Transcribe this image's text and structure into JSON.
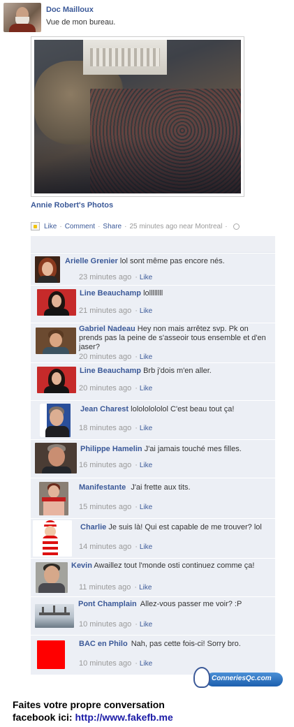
{
  "post": {
    "author": "Doc Mailloux",
    "text": "Vue de mon bureau.",
    "photos_link": "Annie Robert's Photos"
  },
  "actions": {
    "like": "Like",
    "comment": "Comment",
    "share": "Share",
    "timestamp": "25 minutes ago near Montreal",
    "separator": "·"
  },
  "comments": [
    {
      "name": "Arielle Grenier",
      "text": "lol sont même pas encore nés.",
      "time": "23 minutes ago",
      "like": "Like"
    },
    {
      "name": "Line Beauchamp",
      "text": "lollllllll",
      "time": "21 minutes ago",
      "like": "Like"
    },
    {
      "name": "Gabriel Nadeau",
      "text": "Hey non mais arrêtez svp. Pk on prends pas la peine de s'asseoir tous ensemble et d'en jaser?",
      "time": "20 minutes ago",
      "like": "Like"
    },
    {
      "name": "Line Beauchamp",
      "text": "Brb j'dois m'en aller.",
      "time": "20 minutes ago",
      "like": "Like"
    },
    {
      "name": "Jean Charest",
      "text": "lolololololol C'est beau tout ça!",
      "time": "18 minutes ago",
      "like": "Like"
    },
    {
      "name": "Philippe Hamelin",
      "text": "J'ai jamais touché mes filles.",
      "time": "16 minutes ago",
      "like": "Like"
    },
    {
      "name": "Manifestante",
      "text": "J'ai frette aux tits.",
      "time": "15 minutes ago",
      "like": "Like"
    },
    {
      "name": "Charlie",
      "text": "Je suis là! Qui est capable de me trouver? lol",
      "time": "14 minutes ago",
      "like": "Like"
    },
    {
      "name": "Kevin",
      "text": "Awaillez tout l'monde osti continuez comme ça!",
      "time": "11 minutes ago",
      "like": "Like"
    },
    {
      "name": "Pont Champlain",
      "text": "Allez-vous passer me voir? :P",
      "time": "10 minutes ago",
      "like": "Like"
    },
    {
      "name": "BAC en Philo",
      "text": "Nah, pas cette fois-ci! Sorry bro.",
      "time": "10 minutes ago",
      "like": "Like"
    }
  ],
  "branding": {
    "logo_text": "ConneriesQc.com"
  },
  "footer": {
    "line1": "Faites votre propre conversation",
    "line2_prefix": "facebook ici: ",
    "url": "http://www.fakefb.me"
  },
  "colors": {
    "link": "#3b5998",
    "comment_bg": "#eceff5",
    "meta_gray": "#999999",
    "footer_url": "#1a1aa6",
    "bac_red": "#ff0000"
  }
}
